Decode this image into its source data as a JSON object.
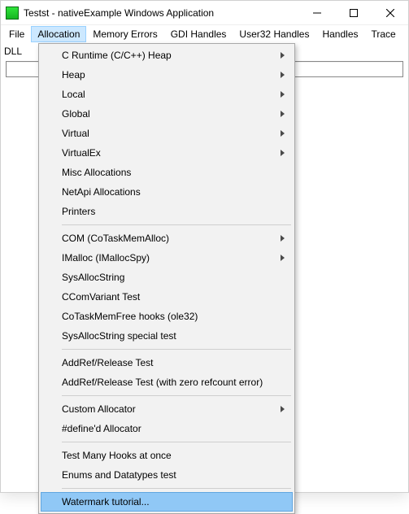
{
  "window": {
    "title": "Testst - nativeExample Windows Application"
  },
  "menubar": {
    "items": [
      {
        "label": "File"
      },
      {
        "label": "Allocation",
        "open": true
      },
      {
        "label": "Memory Errors"
      },
      {
        "label": "GDI Handles"
      },
      {
        "label": "User32 Handles"
      },
      {
        "label": "Handles"
      },
      {
        "label": "Trace"
      }
    ]
  },
  "toolbar": {
    "label_dll": "DLL"
  },
  "dropdown": {
    "items": [
      {
        "label": "C Runtime (C/C++) Heap",
        "submenu": true
      },
      {
        "label": "Heap",
        "submenu": true
      },
      {
        "label": "Local",
        "submenu": true
      },
      {
        "label": "Global",
        "submenu": true
      },
      {
        "label": "Virtual",
        "submenu": true
      },
      {
        "label": "VirtualEx",
        "submenu": true
      },
      {
        "label": "Misc Allocations"
      },
      {
        "label": "NetApi Allocations"
      },
      {
        "label": "Printers"
      },
      {
        "sep": true
      },
      {
        "label": "COM (CoTaskMemAlloc)",
        "submenu": true
      },
      {
        "label": "IMalloc (IMallocSpy)",
        "submenu": true
      },
      {
        "label": "SysAllocString"
      },
      {
        "label": "CComVariant Test"
      },
      {
        "label": "CoTaskMemFree hooks (ole32)"
      },
      {
        "label": "SysAllocString special test"
      },
      {
        "sep": true
      },
      {
        "label": "AddRef/Release Test"
      },
      {
        "label": "AddRef/Release Test (with zero refcount error)"
      },
      {
        "sep": true
      },
      {
        "label": "Custom Allocator",
        "submenu": true
      },
      {
        "label": "#define'd Allocator"
      },
      {
        "sep": true
      },
      {
        "label": "Test Many Hooks at once"
      },
      {
        "label": "Enums and Datatypes test"
      },
      {
        "sep": true
      },
      {
        "label": "Watermark tutorial...",
        "highlight": true
      }
    ]
  }
}
